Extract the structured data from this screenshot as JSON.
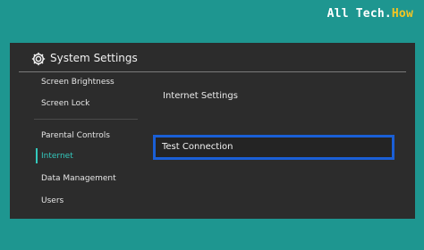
{
  "watermark": {
    "prefix": "All Tech.",
    "accent": "How"
  },
  "header": {
    "title": "System Settings",
    "icon": "gear-icon"
  },
  "sidebar": {
    "items": [
      {
        "label": "Screen Brightness"
      },
      {
        "label": "Screen Lock"
      },
      {
        "label": "Parental Controls"
      },
      {
        "label": "Internet",
        "active": true
      },
      {
        "label": "Data Management"
      },
      {
        "label": "Users"
      }
    ]
  },
  "content": {
    "items": [
      {
        "label": "Internet Settings"
      },
      {
        "label": "Test Connection",
        "selected": true
      }
    ]
  },
  "colors": {
    "background": "#1e9690",
    "panel": "#2c2c2c",
    "accent": "#33c9bd",
    "selection_border": "#1a5fd6",
    "watermark_accent": "#f3c623"
  }
}
